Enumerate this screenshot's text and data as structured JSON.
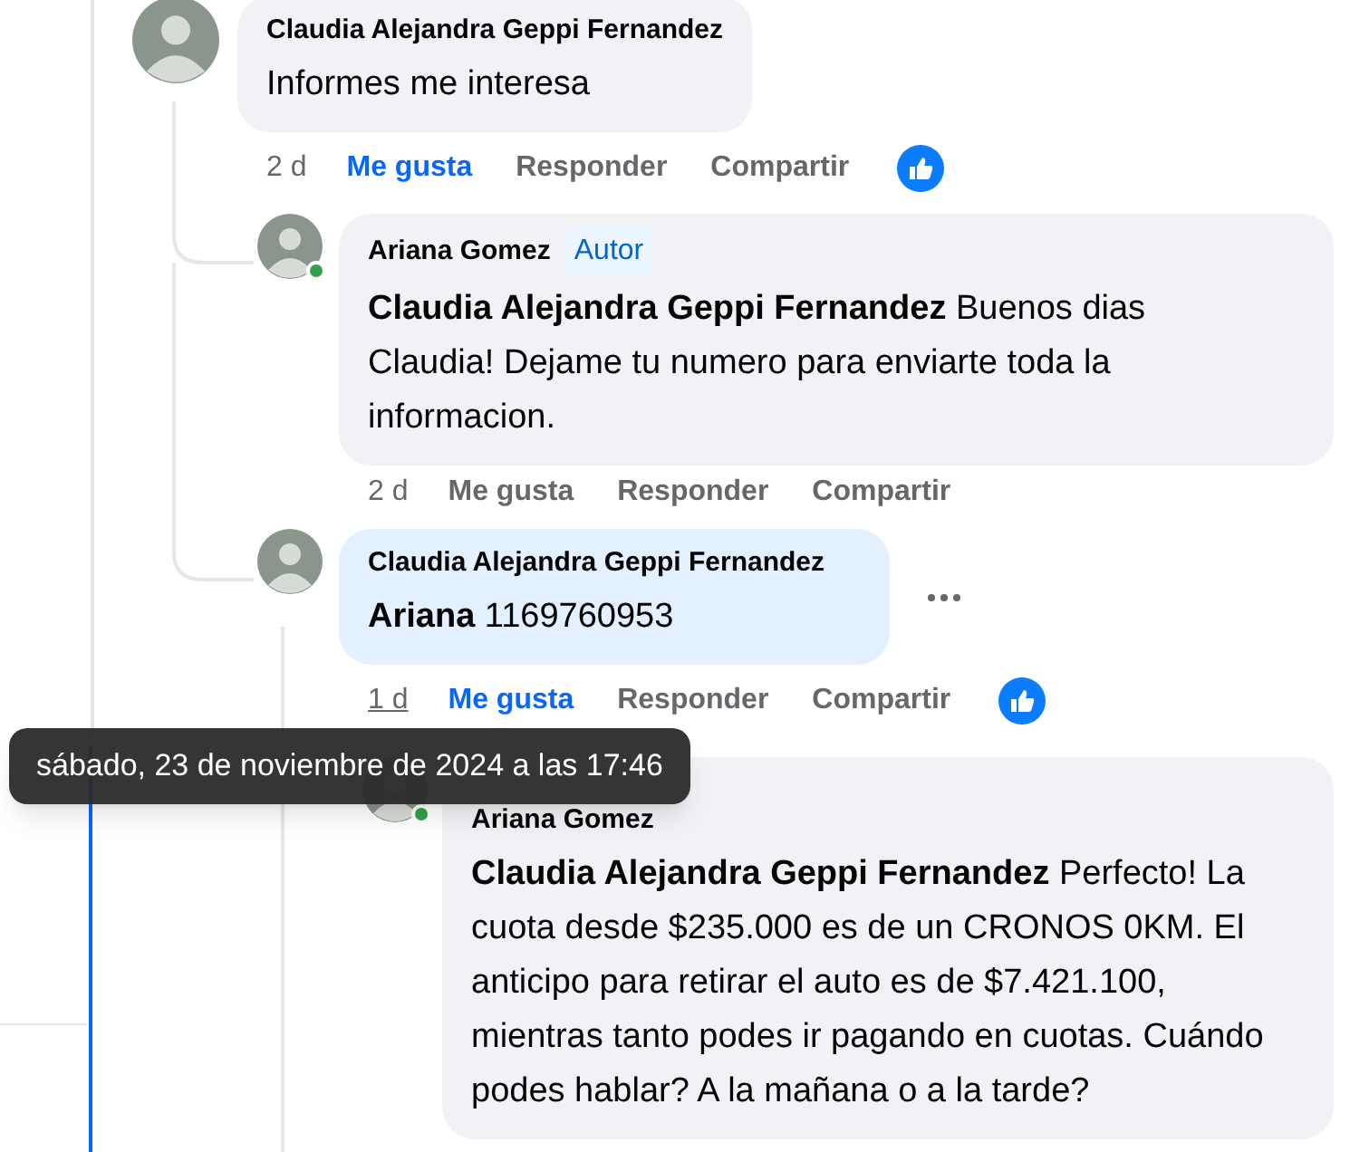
{
  "comments": [
    {
      "author": "Claudia Alejandra Geppi Fernandez",
      "text": "Informes me interesa",
      "highlighted": false,
      "time": "2 d",
      "time_underlined": false,
      "liked": true,
      "reaction_icon": true,
      "actions": [
        "Me gusta",
        "Responder",
        "Compartir"
      ],
      "children": [
        {
          "author": "Ariana Gomez",
          "badge": "Autor",
          "text": "**Claudia Alejandra Geppi Fernandez** Buenos dias Claudia! Dejame tu numero para enviarte toda la informacion.",
          "highlighted": false,
          "online": true,
          "time": "2 d",
          "time_underlined": false,
          "liked": false,
          "actions": [
            "Me gusta",
            "Responder",
            "Compartir"
          ]
        },
        {
          "author": "Claudia Alejandra Geppi Fernandez",
          "text": "**Ariana** 1169760953",
          "highlighted": true,
          "time": "1 d",
          "time_underlined": true,
          "liked": true,
          "reaction_icon": true,
          "more_menu": true,
          "actions": [
            "Me gusta",
            "Responder",
            "Compartir"
          ],
          "children": [
            {
              "author": "Ariana Gomez",
              "text": "**Claudia Alejandra Geppi Fernandez** Perfecto! La cuota desde $235.000 es de un CRONOS 0KM. El anticipo para retirar el auto es de $7.421.100, mientras tanto podes ir pagando en cuotas. Cuándo podes hablar? A la mañana o a la tarde?",
              "highlighted": false,
              "online": true
            }
          ]
        }
      ]
    }
  ],
  "tooltip": {
    "text": "sábado, 23 de noviembre de 2024 a las 17:46"
  }
}
